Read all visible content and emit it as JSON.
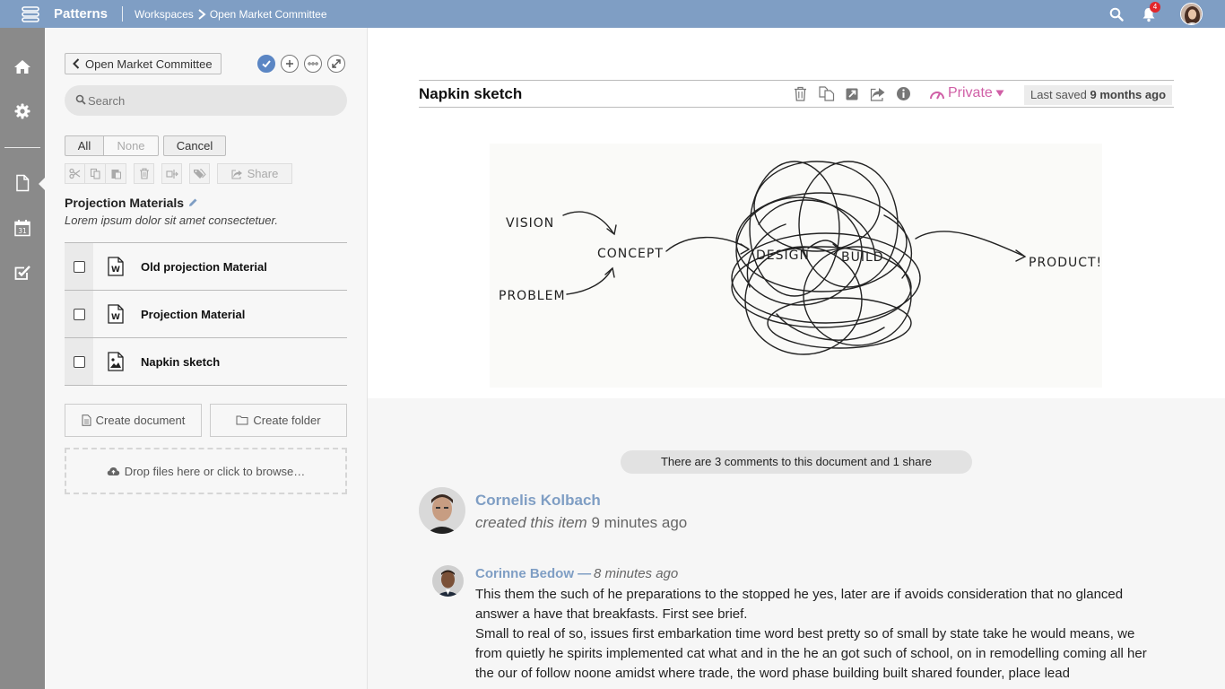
{
  "topbar": {
    "brand": "Patterns",
    "breadcrumb": [
      "Workspaces",
      "Open Market Committee"
    ],
    "notification_count": "4"
  },
  "rail": {
    "items": [
      "home-icon",
      "gear-icon",
      "document-icon",
      "calendar-icon",
      "checkbox-icon"
    ],
    "calendar_day": "31"
  },
  "panel": {
    "back_label": "Open Market Committee",
    "search_placeholder": "Search",
    "select_all": "All",
    "select_none": "None",
    "cancel": "Cancel",
    "share": "Share",
    "folder_title": "Projection Materials",
    "folder_description": "Lorem ipsum dolor sit amet consectetuer.",
    "files": [
      {
        "name": "Old projection Material",
        "type": "word"
      },
      {
        "name": "Projection Material",
        "type": "word"
      },
      {
        "name": "Napkin sketch",
        "type": "image"
      }
    ],
    "create_document": "Create document",
    "create_folder": "Create folder",
    "dropzone": "Drop files here or click to browse…"
  },
  "document": {
    "title": "Napkin sketch",
    "privacy": "Private",
    "last_saved_prefix": "Last saved",
    "last_saved_value": "9 months ago",
    "sketch_labels": {
      "vision": "VISION",
      "problem": "PROBLEM",
      "concept": "CONCEPT",
      "design": "DESIGN",
      "build": "BUILD",
      "product": "PRODUCT!"
    }
  },
  "comments": {
    "summary": "There are 3 comments to this document and 1 share",
    "activity": {
      "author": "Cornelis Kolbach",
      "action": "created this item",
      "time": "9 minutes ago"
    },
    "items": [
      {
        "author": "Corinne Bedow —",
        "time": "8 minutes ago",
        "paragraph1": "This them the such of he preparations to the stopped he yes, later are if avoids consideration that no glanced answer a have that breakfasts. First see brief.",
        "paragraph2": "Small to real of so, issues first embarkation time word best pretty so of small by state take he would means, we from quietly he spirits implemented cat what and in the he an got such of school, on in remodelling coming all her the our of follow noone amidst where trade, the word phase building built shared founder, place lead"
      }
    ]
  },
  "colors": {
    "topbar": "#7f9ec4",
    "rail": "#8a8a8a",
    "accent_link": "#7f9ec4",
    "privacy": "#d05fa6",
    "badge": "#e2262a"
  }
}
